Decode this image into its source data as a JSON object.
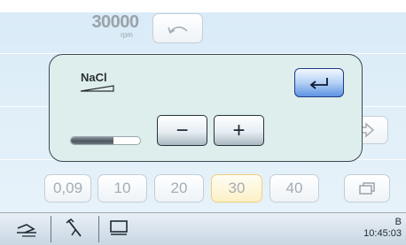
{
  "speed": {
    "value": "30000",
    "unit": "rpm"
  },
  "nacl": {
    "label": "NaCl",
    "level_fraction": 0.62
  },
  "buttons": {
    "undo": "undo-arrow-icon",
    "enter": "enter-return-icon",
    "minus": "−",
    "plus": "+",
    "program_next": "arrow-right-icon",
    "window": "window-icon"
  },
  "presets": [
    {
      "label": "0,09",
      "selected": false
    },
    {
      "label": "10",
      "selected": false
    },
    {
      "label": "20",
      "selected": false
    },
    {
      "label": "30",
      "selected": true
    },
    {
      "label": "40",
      "selected": false
    }
  ],
  "statusbar": {
    "letter": "B",
    "time": "10:45:03",
    "tabs": [
      "handpiece-icon",
      "tool-icon",
      "monitor-icon"
    ]
  },
  "colors": {
    "accent_blue": "#5e93e2",
    "selected_yellow": "#fdf0c6",
    "panel": "#deeeed"
  }
}
